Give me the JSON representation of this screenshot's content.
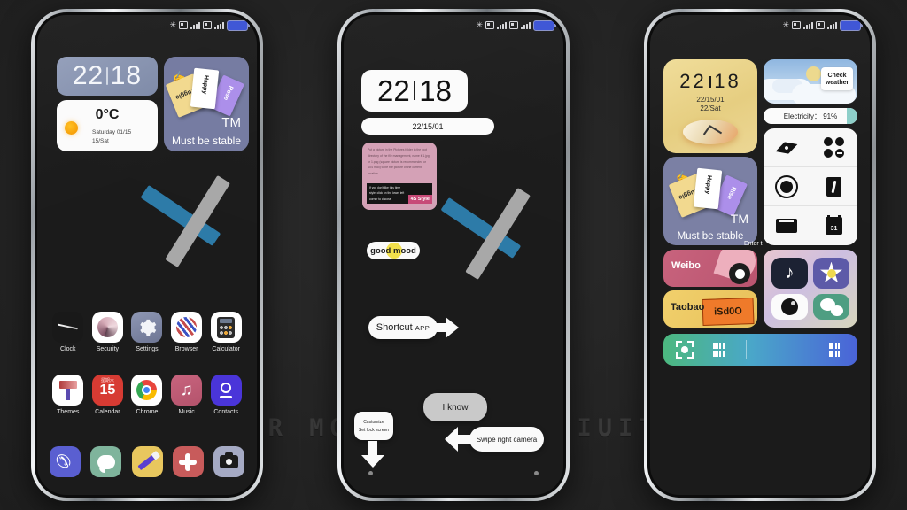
{
  "watermark": "..VISIT FOR MORE THEMES MIUITHEMER.COM",
  "statusbar": {
    "bluetooth_icon": "bluetooth-icon",
    "sim1_icon": "sim-card-icon",
    "sim2_icon": "sim-card-icon",
    "signal_icon": "signal-bars-icon",
    "battery_icon": "battery-icon"
  },
  "phone1": {
    "clock": {
      "hours": "22",
      "minutes": "18"
    },
    "weather": {
      "temp": "0°C",
      "date_line1": "Saturday 01/15",
      "date_line2": "15/Sat",
      "icon": "sun-icon"
    },
    "notes_widget": {
      "card1": "Struggle",
      "card2": "Happy",
      "card3": "Rose",
      "tm": "TM",
      "caption": "Must be stable"
    },
    "apps": [
      {
        "label": "Clock",
        "icon": "clock-app-icon"
      },
      {
        "label": "Security",
        "icon": "security-app-icon"
      },
      {
        "label": "Settings",
        "icon": "settings-gear-icon"
      },
      {
        "label": "Browser",
        "icon": "browser-app-icon"
      },
      {
        "label": "Calculator",
        "icon": "calculator-app-icon"
      },
      {
        "label": "Themes",
        "icon": "themes-app-icon"
      },
      {
        "label": "Calendar",
        "icon": "calendar-app-icon",
        "weekday": "星期六",
        "day": "15"
      },
      {
        "label": "Chrome",
        "icon": "chrome-app-icon"
      },
      {
        "label": "Music",
        "icon": "music-app-icon",
        "glyph": "♫"
      },
      {
        "label": "Contacts",
        "icon": "contacts-app-icon"
      }
    ],
    "dock": [
      {
        "label": "Phone",
        "icon": "phone-dock-icon",
        "glyph": "✆"
      },
      {
        "label": "Messages",
        "icon": "messages-dock-icon"
      },
      {
        "label": "Notes",
        "icon": "notes-dock-icon"
      },
      {
        "label": "Mi Apps",
        "icon": "mi-apps-dock-icon"
      },
      {
        "label": "Camera",
        "icon": "camera-dock-icon"
      }
    ]
  },
  "phone2": {
    "clock": {
      "hours": "22",
      "minutes": "18"
    },
    "date": "22/15/01",
    "note": {
      "body": "Put a picture in the Pictures folder in the root directory of the file management, name it 1.jpg or 1.png (square picture is recommended or 4X4 mod) to be the picture of the current location",
      "strip_text": "If you don't like this time style, click on the lower left corner to choose",
      "strip_badge": "4S Style"
    },
    "mood_chip": "good mood",
    "shortcut_bubble": {
      "main": "Shortcut",
      "sub": "APP"
    },
    "i_know_bubble": "I know",
    "swipe_bubble": "Swipe right camera",
    "customize_bubble": {
      "line1": "Customize",
      "line2": "Set lock screen"
    }
  },
  "phone3": {
    "clock": {
      "hours": "22",
      "minutes": "18",
      "date1": "22/15/01",
      "date2": "22/Sat",
      "dial_icon": "analog-dial-icon"
    },
    "notes_widget": {
      "card1": "Struggle",
      "card2": "Happy",
      "card3": "Rise",
      "tm": "TM",
      "caption": "Must be stable"
    },
    "enter_label": "Enter t",
    "weather": {
      "button_line1": "Check",
      "button_line2": "weather",
      "icon": "sun-cloud-icon"
    },
    "battery": {
      "label": "Electricity：",
      "value": "91%"
    },
    "tools": [
      {
        "name": "compass-icon"
      },
      {
        "name": "apps-grid-icon"
      },
      {
        "name": "recorder-icon"
      },
      {
        "name": "notes-icon"
      },
      {
        "name": "mail-icon"
      },
      {
        "name": "calendar-icon",
        "day": "31"
      }
    ],
    "weibo": {
      "label": "Weibo",
      "icon": "weibo-icon"
    },
    "taobao": {
      "label": "Taobao",
      "tag": "iSd0O",
      "icon": "taobao-icon"
    },
    "folder": [
      {
        "name": "tiktok-icon",
        "glyph": "♪"
      },
      {
        "name": "flower-icon"
      },
      {
        "name": "camera-icon"
      },
      {
        "name": "wechat-icon"
      }
    ],
    "scan_bar": {
      "scan_icon": "qr-scan-icon",
      "barcode_icon": "barcode-icon"
    }
  },
  "colors": {
    "background": "#242424",
    "accent_blue": "#2d7ba8",
    "accent_gray": "#a8a8a8",
    "widget_purple": "#767ca2",
    "widget_yellow": "#e6ce81",
    "battery_blue": "#4057d6"
  }
}
